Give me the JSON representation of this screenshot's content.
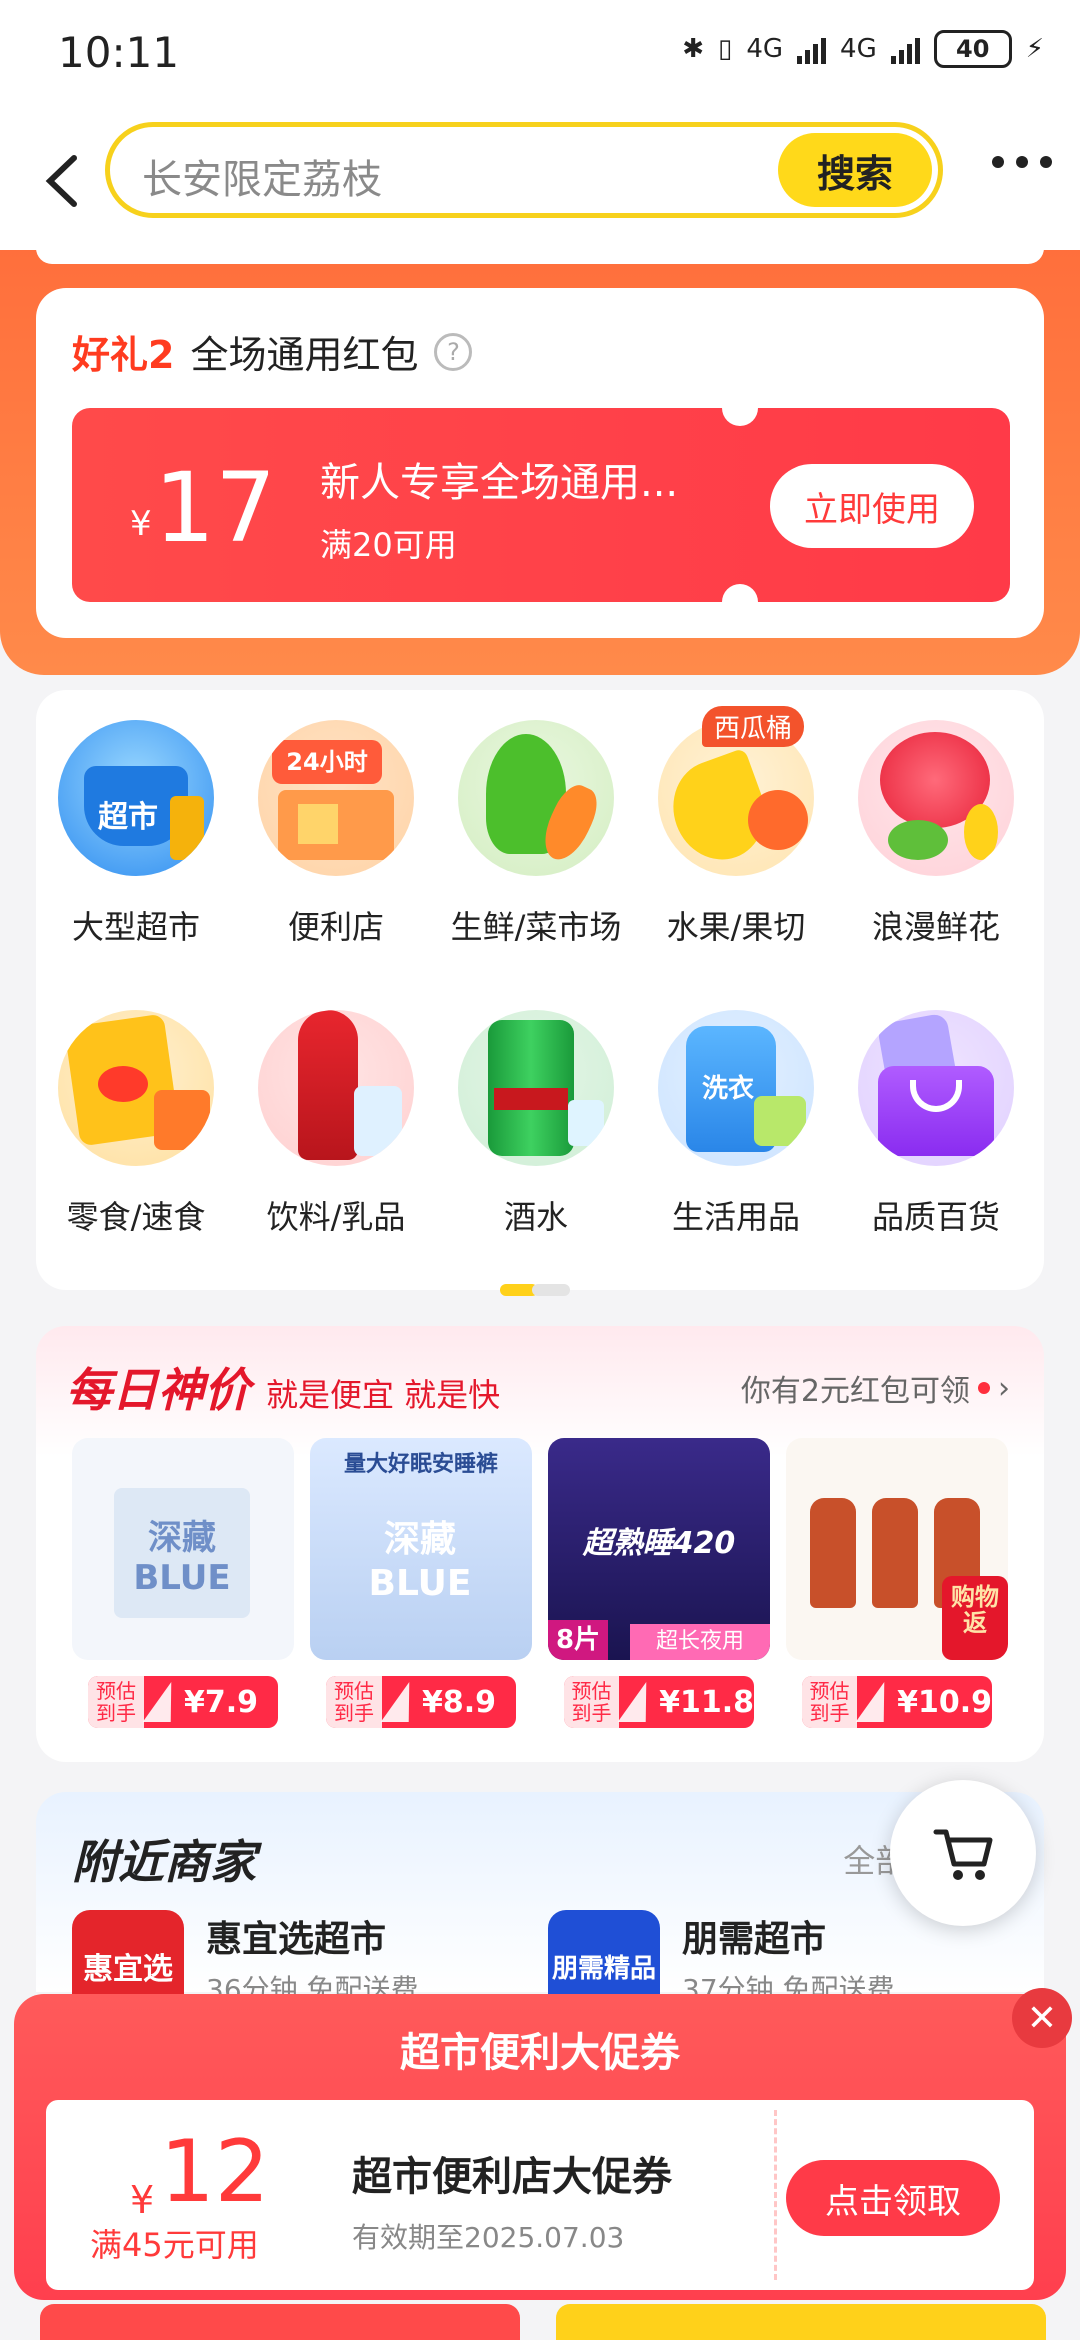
{
  "status_bar": {
    "time": "10:11",
    "net1": "4G",
    "net2": "4G",
    "battery": "40"
  },
  "header": {
    "search_placeholder": "长安限定荔枝",
    "search_button": "搜索"
  },
  "gift": {
    "tag": "好礼2",
    "title": "全场通用红包",
    "help": "?",
    "coupon": {
      "currency": "¥",
      "amount": "17",
      "title": "新人专享全场通用...",
      "condition": "满20可用",
      "button": "立即使用"
    }
  },
  "categories": [
    {
      "label": "大型超市",
      "icon": "supermarket-basket-icon"
    },
    {
      "label": "便利店",
      "icon": "convenience-store-icon"
    },
    {
      "label": "生鲜/菜市场",
      "icon": "vegetable-icon"
    },
    {
      "label": "水果/果切",
      "icon": "fruit-icon",
      "badge": "西瓜桶"
    },
    {
      "label": "浪漫鲜花",
      "icon": "rose-icon"
    },
    {
      "label": "零食/速食",
      "icon": "snack-icon"
    },
    {
      "label": "饮料/乳品",
      "icon": "cola-bottle-icon"
    },
    {
      "label": "酒水",
      "icon": "beer-can-icon"
    },
    {
      "label": "生活用品",
      "icon": "detergent-icon"
    },
    {
      "label": "品质百货",
      "icon": "shopping-bag-icon"
    }
  ],
  "daily_deals": {
    "title": "每日神价",
    "slogan": "就是便宜 就是快",
    "more": "你有2元红包可领",
    "products": [
      {
        "est": "预估到手",
        "price": "¥7.9",
        "img_text": "深藏 BLUE"
      },
      {
        "est": "预估到手",
        "price": "¥8.9",
        "img_text": "深藏 BLUE",
        "img_caption": "量大好眠安睡裤"
      },
      {
        "est": "预估到手",
        "price": "¥11.8",
        "img_text": "超熟睡420",
        "img_tag": "8片",
        "img_caption": "超长夜用"
      },
      {
        "est": "预估到手",
        "price": "¥10.9",
        "img_tag": "购物返"
      }
    ]
  },
  "nearby": {
    "title": "附近商家",
    "all": "全部60",
    "shops": [
      {
        "logo": "惠宜选",
        "name": "惠宜选超市",
        "meta": "36分钟 免配送费",
        "color": "#e4252b"
      },
      {
        "logo": "朋需精品",
        "name": "朋需超市",
        "meta": "37分钟 免配送费",
        "color": "#1f4fd6"
      }
    ]
  },
  "popup": {
    "title": "超市便利大促券",
    "close": "✕",
    "currency": "¥",
    "amount": "12",
    "condition": "满45元可用",
    "name": "超市便利店大促券",
    "validity": "有效期至2025.07.03",
    "button": "点击领取"
  },
  "colors": {
    "accent_yellow": "#ffd91a",
    "accent_red": "#ff3a48",
    "orange": "#ff7a44"
  }
}
